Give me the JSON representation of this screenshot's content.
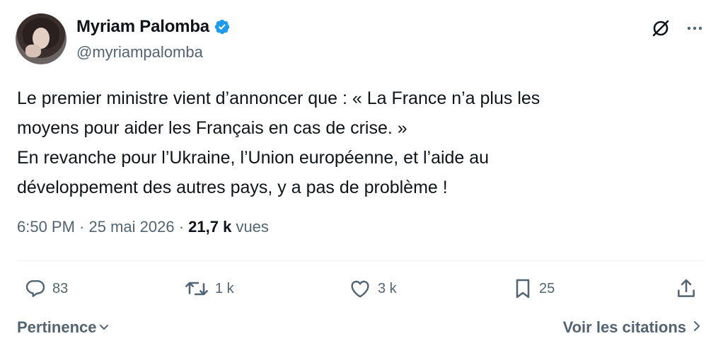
{
  "author": {
    "name": "Myriam Palomba",
    "handle": "@myriampalomba",
    "verified": true
  },
  "tweet": {
    "text": "Le premier ministre vient d’annoncer que : « La France n’a plus les\nmoyens pour aider les Français en cas de crise. »\nEn revanche pour l’Ukraine, l’Union européenne, et l’aide au\ndéveloppement des autres pays, y a pas de problème !"
  },
  "meta": {
    "time": "6:50 PM",
    "separator1": " · ",
    "date": "25 mai 2026",
    "separator2": " · ",
    "views_count": "21,7 k",
    "views_label": " vues"
  },
  "actions": {
    "replies": "83",
    "reposts": "1 k",
    "likes": "3 k",
    "bookmarks": "25"
  },
  "bottom": {
    "sort_label": "Pertinence",
    "quotes_label": "Voir les citations"
  },
  "colors": {
    "verified": "#1d9bf0",
    "text": "#0f1419",
    "secondary": "#536471"
  },
  "icons": {
    "grok": "grok-icon",
    "more": "more-icon",
    "reply": "reply-icon",
    "repost": "repost-icon",
    "like": "like-icon",
    "bookmark": "bookmark-icon",
    "share": "share-icon"
  }
}
